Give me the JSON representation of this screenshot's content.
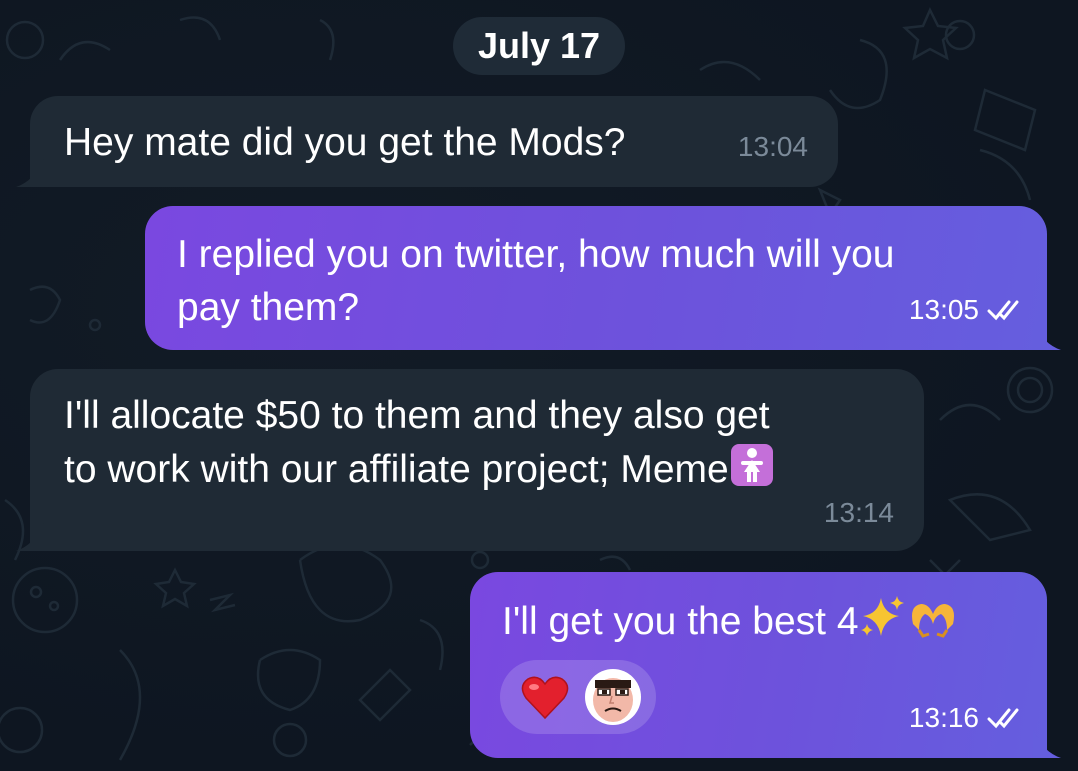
{
  "chat": {
    "date_separator": "July 17",
    "messages": [
      {
        "direction": "incoming",
        "line1": "Hey mate did you get the Mods?",
        "time": "13:04"
      },
      {
        "direction": "outgoing",
        "line1": "I replied you on twitter, how much will you",
        "line2": "pay them?",
        "time": "13:05",
        "status": "read"
      },
      {
        "direction": "incoming",
        "line1": "I'll allocate $50 to them and they also get",
        "line2": "to work with our affiliate project; Meme",
        "emoji": "woman-standing-emoji",
        "time": "13:14"
      },
      {
        "direction": "outgoing",
        "line1": "I'll get you the best 4",
        "emojis": [
          "sparkles-emoji",
          "heart-hands-emoji"
        ],
        "time": "13:16",
        "status": "read",
        "reactions": [
          "red-heart",
          "angry-face-sticker"
        ]
      }
    ]
  },
  "colors": {
    "background": "#0e1621",
    "incoming_bubble": "#1f2a35",
    "outgoing_gradient_start": "#7a48e0",
    "outgoing_gradient_end": "#655ede",
    "incoming_time": "#7b8a99"
  }
}
